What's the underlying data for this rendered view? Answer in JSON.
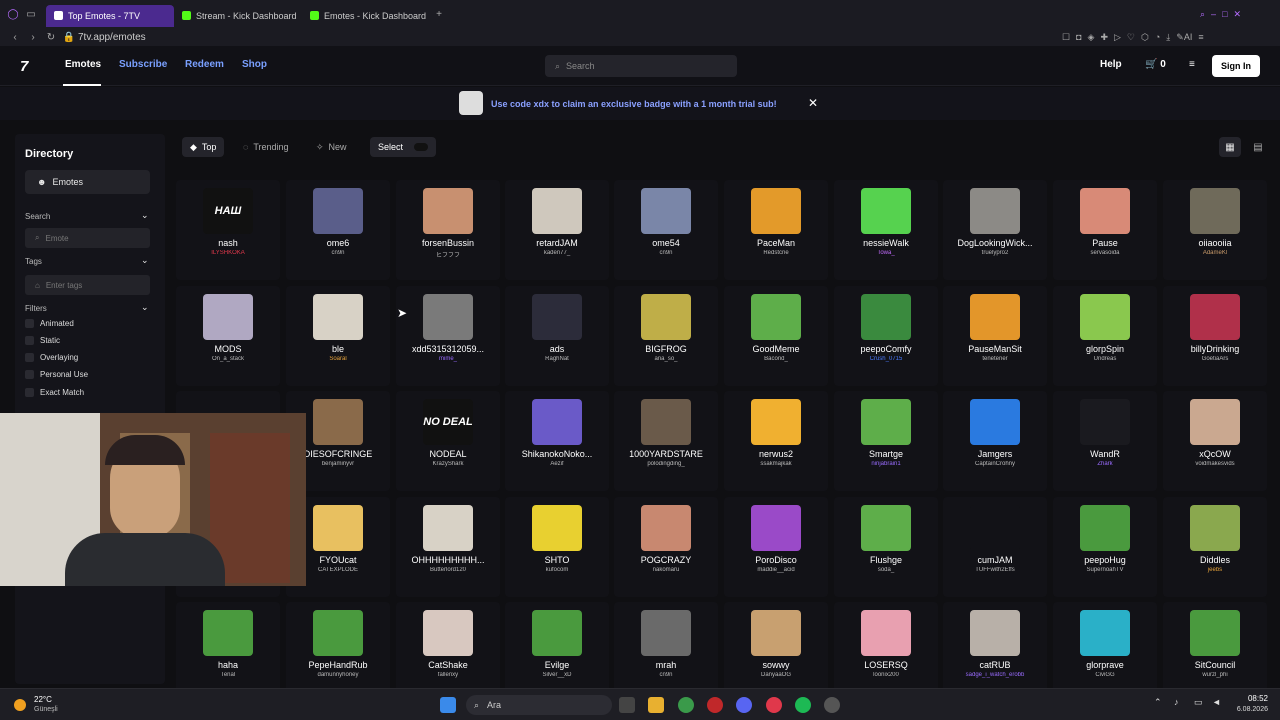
{
  "browser": {
    "tabs": [
      {
        "label": "Top Emotes - 7TV",
        "active": true,
        "color": "#ffffff"
      },
      {
        "label": "Stream - Kick Dashboard",
        "active": false,
        "color": "#53fc18"
      },
      {
        "label": "Emotes - Kick Dashboard",
        "active": false,
        "color": "#53fc18"
      }
    ],
    "url": "7tv.app/emotes",
    "ai_label": "AI"
  },
  "header": {
    "logo": "7",
    "nav": [
      "Emotes",
      "Subscribe",
      "Redeem",
      "Shop"
    ],
    "search_placeholder": "Search",
    "help": "Help",
    "cart_count": "0",
    "signin": "Sign In"
  },
  "banner": {
    "text": "Use code xdx to claim an exclusive badge with a 1 month trial sub!"
  },
  "sidebar": {
    "title": "Directory",
    "emotes": "Emotes",
    "search_label": "Search",
    "search_placeholder": "Emote",
    "tags_label": "Tags",
    "tags_placeholder": "Enter tags",
    "filters_label": "Filters",
    "filters": [
      "Animated",
      "Static",
      "Overlaying",
      "Personal Use",
      "Exact Match"
    ]
  },
  "toolbar": {
    "top": "Top",
    "trending": "Trending",
    "new": "New",
    "select": "Select"
  },
  "emotes": [
    {
      "name": "nash",
      "owner": "ILYSHKOKA",
      "owner_color": "#e0384b",
      "thumb": "#111111",
      "label": "НАШ"
    },
    {
      "name": "ome6",
      "owner": "cn9n",
      "owner_color": "#bbbbbb",
      "thumb": "#5a5e8a"
    },
    {
      "name": "forsenBussin",
      "owner": "ヒフフフ",
      "owner_color": "#bbbbbb",
      "thumb": "#c89070"
    },
    {
      "name": "retardJAM",
      "owner": "kaden77_",
      "owner_color": "#bbbbbb",
      "thumb": "#cfc8bd"
    },
    {
      "name": "ome54",
      "owner": "cn9n",
      "owner_color": "#bbbbbb",
      "thumb": "#7a86a8"
    },
    {
      "name": "PaceMan",
      "owner": "Redstcne",
      "owner_color": "#bbbbbb",
      "thumb": "#e39a2a"
    },
    {
      "name": "nessieWalk",
      "owner": "Towa_",
      "owner_color": "#c36cff",
      "thumb": "#56d24f"
    },
    {
      "name": "DogLookingWick...",
      "owner": "truelypro2",
      "owner_color": "#bbbbbb",
      "thumb": "#8c8a86"
    },
    {
      "name": "Pause",
      "owner": "servasoida",
      "owner_color": "#bbbbbb",
      "thumb": "#d88a77"
    },
    {
      "name": "oiiaooiia",
      "owner": "AdameKl",
      "owner_color": "#c89a6a",
      "thumb": "#6f6a5a"
    },
    {
      "name": "MODS",
      "owner": "On_a_stack",
      "owner_color": "#bbbbbb",
      "thumb": "#b0a8c2"
    },
    {
      "name": "ble",
      "owner": "Soaral",
      "owner_color": "#e5a23b",
      "thumb": "#d8d2c6"
    },
    {
      "name": "xdd5315312059...",
      "owner": "mime_",
      "owner_color": "#9a6cff",
      "thumb": "#7a7a7a"
    },
    {
      "name": "ads",
      "owner": "RaghNat",
      "owner_color": "#bbbbbb",
      "thumb": "#2c2c3a"
    },
    {
      "name": "BIGFROG",
      "owner": "ana_so_",
      "owner_color": "#bbbbbb",
      "thumb": "#bfae48"
    },
    {
      "name": "GoodMeme",
      "owner": "Bacond_",
      "owner_color": "#bbbbbb",
      "thumb": "#5eae4a"
    },
    {
      "name": "peepoComfy",
      "owner": "Crush_0715",
      "owner_color": "#4a7aff",
      "thumb": "#3a8a3e"
    },
    {
      "name": "PauseManSit",
      "owner": "tenetener",
      "owner_color": "#bbbbbb",
      "thumb": "#e3962a"
    },
    {
      "name": "glorpSpin",
      "owner": "Undreas",
      "owner_color": "#bbbbbb",
      "thumb": "#8ac84e"
    },
    {
      "name": "billyDrinking",
      "owner": "GoetiaArs",
      "owner_color": "#bbbbbb",
      "thumb": "#b0304a"
    },
    {
      "name": "",
      "owner": "",
      "owner_color": "#bbbbbb",
      "thumb": "#121217"
    },
    {
      "name": "DIESOFCRINGE",
      "owner": "benjaminyvr",
      "owner_color": "#bbbbbb",
      "thumb": "#8a6a4a"
    },
    {
      "name": "NODEAL",
      "owner": "KrazyShark",
      "owner_color": "#bbbbbb",
      "thumb": "#111111",
      "label": "NO DEAL"
    },
    {
      "name": "ShikanokoNoko...",
      "owner": "Aezif",
      "owner_color": "#bbbbbb",
      "thumb": "#6a5ac8"
    },
    {
      "name": "1000YARDSTARE",
      "owner": "polodingding_",
      "owner_color": "#bbbbbb",
      "thumb": "#6a5a4a"
    },
    {
      "name": "nerwus2",
      "owner": "ssakmajkak",
      "owner_color": "#bbbbbb",
      "thumb": "#f0b030"
    },
    {
      "name": "Smartge",
      "owner": "ninjabrain1",
      "owner_color": "#9a6cff",
      "thumb": "#5eae4a"
    },
    {
      "name": "Jamgers",
      "owner": "CaptainCrohny",
      "owner_color": "#bbbbbb",
      "thumb": "#2a7ae0"
    },
    {
      "name": "WandR",
      "owner": "Zhark",
      "owner_color": "#9a6cff",
      "thumb": "#1a1a1f"
    },
    {
      "name": "xQcOW",
      "owner": "voidmakesvids",
      "owner_color": "#bbbbbb",
      "thumb": "#caa890"
    },
    {
      "name": "",
      "owner": "",
      "owner_color": "#bbbbbb",
      "thumb": "#121217"
    },
    {
      "name": "FYOUcat",
      "owner": "CATEXPLODE",
      "owner_color": "#bbbbbb",
      "thumb": "#e8c060"
    },
    {
      "name": "OHHHHHHHHH...",
      "owner": "Butterlord120",
      "owner_color": "#bbbbbb",
      "thumb": "#d8d2c6"
    },
    {
      "name": "SHTO",
      "owner": "kufocom",
      "owner_color": "#bbbbbb",
      "thumb": "#e8d030"
    },
    {
      "name": "POGCRAZY",
      "owner": "nakomaru",
      "owner_color": "#bbbbbb",
      "thumb": "#c88870"
    },
    {
      "name": "PoroDisco",
      "owner": "maddie__acid",
      "owner_color": "#bbbbbb",
      "thumb": "#9a4ac8"
    },
    {
      "name": "Flushge",
      "owner": "soda_",
      "owner_color": "#bbbbbb",
      "thumb": "#5eae4a"
    },
    {
      "name": "cumJAM",
      "owner": "TUFFwith2Effs",
      "owner_color": "#bbbbbb",
      "thumb": "#121217"
    },
    {
      "name": "peepoHug",
      "owner": "SupernoahTV",
      "owner_color": "#bbbbbb",
      "thumb": "#4a9a3e"
    },
    {
      "name": "Diddles",
      "owner": "jeebs",
      "owner_color": "#e5a23b",
      "thumb": "#8aa84e"
    },
    {
      "name": "haha",
      "owner": "Tenal",
      "owner_color": "#bbbbbb",
      "thumb": "#4a9a3e"
    },
    {
      "name": "PepeHandRub",
      "owner": "damunnyhoney",
      "owner_color": "#bbbbbb",
      "thumb": "#4a9a3e"
    },
    {
      "name": "CatShake",
      "owner": "fallenxy",
      "owner_color": "#bbbbbb",
      "thumb": "#d8c8c0"
    },
    {
      "name": "Evilge",
      "owner": "Silver__xD",
      "owner_color": "#bbbbbb",
      "thumb": "#4a9a3e"
    },
    {
      "name": "mrah",
      "owner": "cn9n",
      "owner_color": "#bbbbbb",
      "thumb": "#6a6a6a"
    },
    {
      "name": "sowwy",
      "owner": "DanyaaOG",
      "owner_color": "#bbbbbb",
      "thumb": "#c8a070"
    },
    {
      "name": "LOSERSQ",
      "owner": "loonix200",
      "owner_color": "#bbbbbb",
      "thumb": "#e8a0b0"
    },
    {
      "name": "catRUB",
      "owner": "sadge_i_watch_erobb",
      "owner_color": "#9a6cff",
      "thumb": "#b8b0a8"
    },
    {
      "name": "glorprave",
      "owner": "CiviGG",
      "owner_color": "#bbbbbb",
      "thumb": "#2ab0c8"
    },
    {
      "name": "SitCouncil",
      "owner": "wurzl_phi",
      "owner_color": "#bbbbbb",
      "thumb": "#4a9a3e"
    }
  ],
  "taskbar": {
    "temp": "22°C",
    "weather": "Güneşli",
    "search": "Ara",
    "time": "08:52",
    "date": "6.08.2026"
  }
}
